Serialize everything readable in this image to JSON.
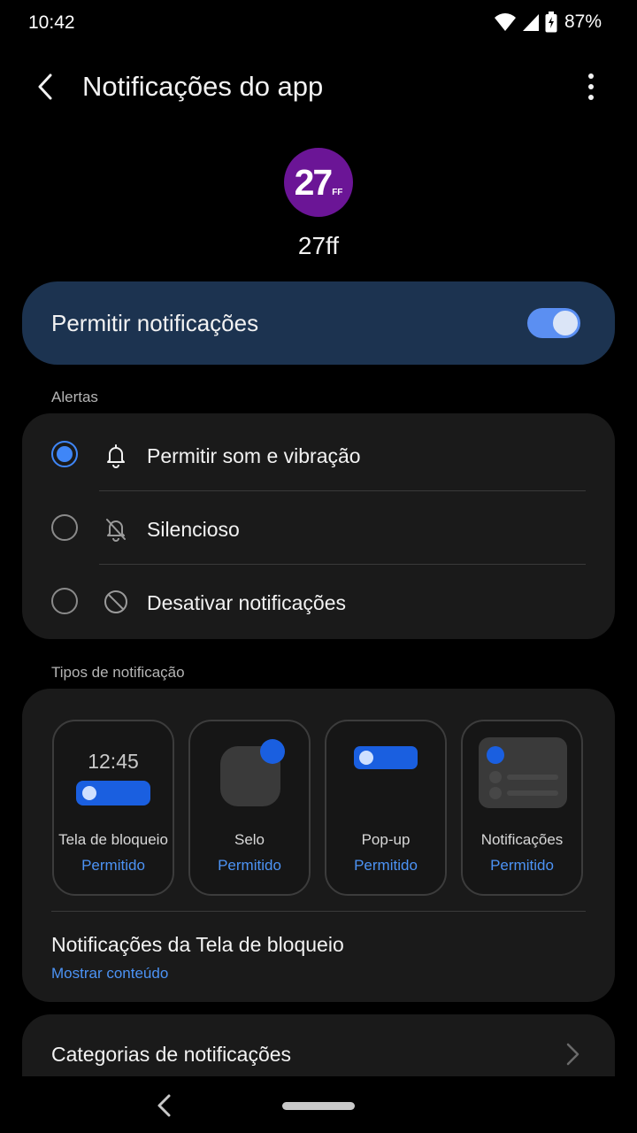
{
  "status_bar": {
    "time": "10:42",
    "battery": "87%"
  },
  "header": {
    "title": "Notificações do app",
    "back_icon": "chevron-left-icon",
    "more_icon": "more-vertical-icon"
  },
  "app": {
    "icon_text_big": "27",
    "icon_text_small": "FF",
    "name": "27ff",
    "icon_color": "#6b1596"
  },
  "allow": {
    "label": "Permitir notificações",
    "enabled": true,
    "accent": "#5b8ff2"
  },
  "alerts": {
    "section_label": "Alertas",
    "options": [
      {
        "label": "Permitir som e vibração",
        "icon": "bell-icon",
        "selected": true
      },
      {
        "label": "Silencioso",
        "icon": "bell-off-icon",
        "selected": false
      },
      {
        "label": "Desativar notificações",
        "icon": "block-icon",
        "selected": false
      }
    ]
  },
  "types": {
    "section_label": "Tipos de notificação",
    "tiles": [
      {
        "name": "Tela de bloqueio",
        "status": "Permitido",
        "preview_time": "12:45"
      },
      {
        "name": "Selo",
        "status": "Permitido"
      },
      {
        "name": "Pop-up",
        "status": "Permitido"
      },
      {
        "name": "Notificações",
        "status": "Permitido"
      }
    ],
    "lockscreen_title": "Notificações da Tela de bloqueio",
    "lockscreen_value": "Mostrar conteúdo"
  },
  "categories": {
    "label": "Categorias de notificações"
  },
  "colors": {
    "link": "#4c93f5",
    "card": "#1a1a1a",
    "allow_card": "#1c3350",
    "accent_blue": "#1a5fe0"
  }
}
